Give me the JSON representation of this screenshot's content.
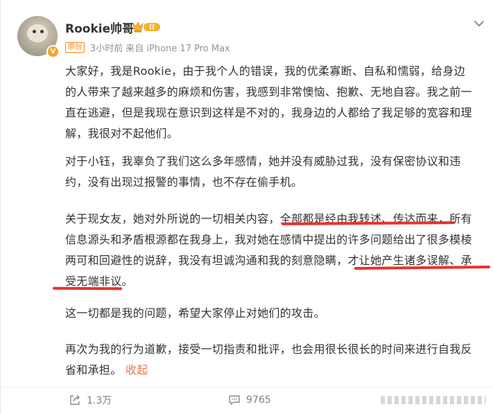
{
  "post": {
    "author": "Rookie帅哥",
    "verified_mark": "V",
    "vip_level": "II",
    "tag": "原创",
    "time": "3小时前",
    "source": "来自 iPhone 17 Pro Max",
    "paragraphs": {
      "p1": [
        "大家好，我是Rookie，由于我个人的错误，我的优柔寡断、自私和懦弱，给身边",
        "的人带来了越来越多的麻烦和伤害，我感到非常懊恼、抱歉、无地自容。我之前一",
        "直在逃避，但是我现在意识到这样是不对的，我身边的人都给了我足够的宽容和理",
        "解，我很对不起他们。"
      ],
      "p2": [
        "对于小钰，我辜负了我们这么多年感情，她并没有威胁过我，没有保密协议和违",
        "约，没有出现过报警的事情，也不存在偷手机。"
      ],
      "p3": [
        "关于现女友，她对外所说的一切相关内容，全部都是经由我转述、传达而来，所有",
        "信息源头和矛盾根源都在我身上，我对她在感情中提出的许多问题给出了很多模棱",
        "两可和回避性的说辞，我没有坦诚沟通和我的刻意隐瞒，才让她产生诸多误解、承",
        "受无端非议。"
      ],
      "p4": "这一切都是我的问题，希望大家停止对她们的攻击。",
      "p5": [
        "再次为我的行为道歉，接受一切指责和批评，也会用很长很长的时间来进行自我反",
        "省和承担。"
      ],
      "collapse_label": "收起"
    }
  },
  "footer": {
    "share_count": "1.3万",
    "comment_count": "9765",
    "share_icon": "share-icon",
    "comment_icon": "comment-icon",
    "like_icon": "like-icon"
  },
  "colors": {
    "accent_orange": "#ff8200",
    "collapse_link": "#eb7350",
    "highlight_underline": "#e8312f",
    "vip_gold": "#f5b22e"
  }
}
